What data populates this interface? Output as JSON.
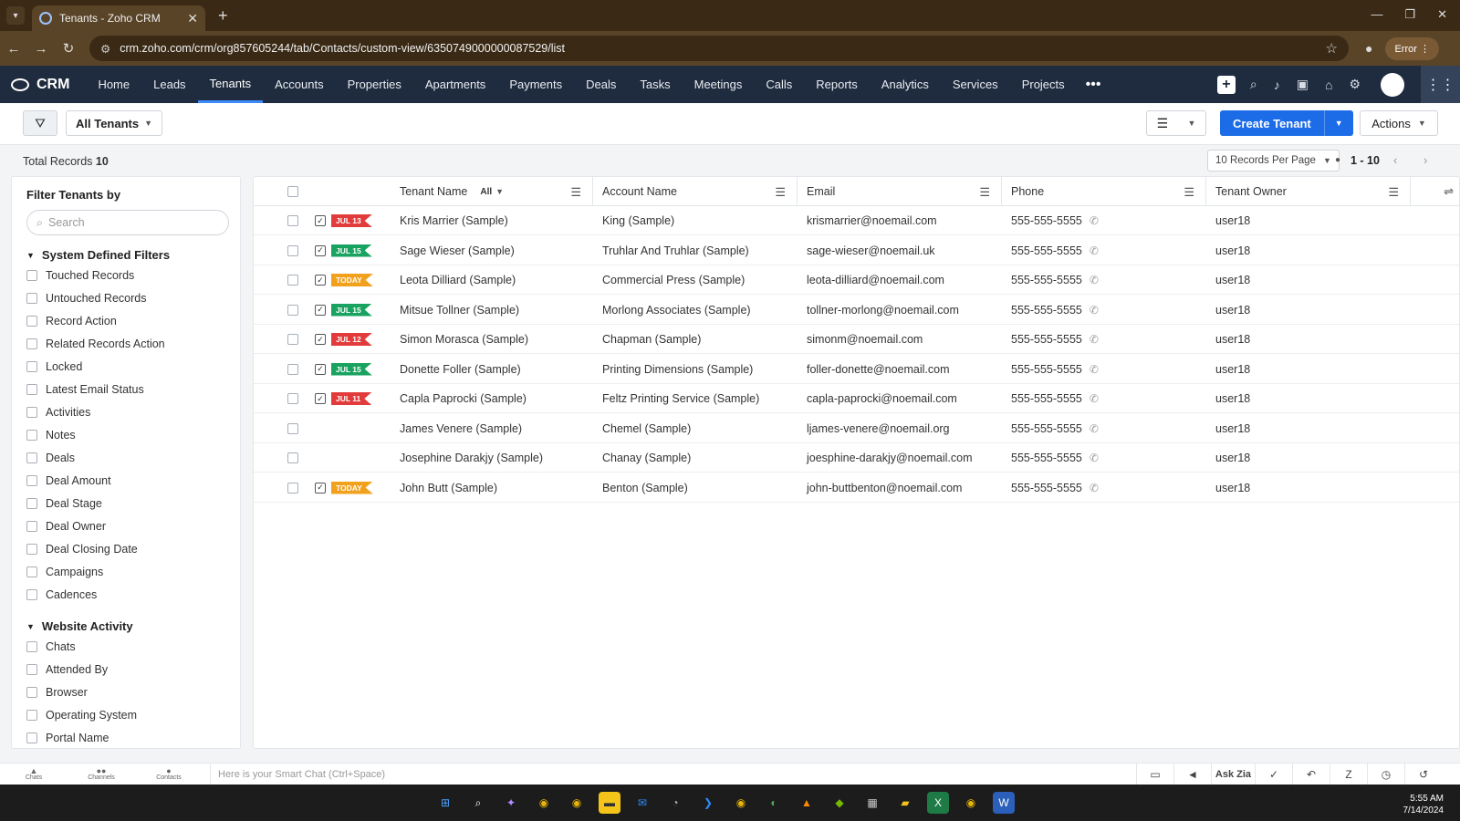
{
  "browser": {
    "tab_title": "Tenants - Zoho CRM",
    "url": "crm.zoho.com/crm/org857605244/tab/Contacts/custom-view/6350749000000087529/list",
    "error_label": "Error"
  },
  "nav": {
    "logo": "CRM",
    "items": [
      "Home",
      "Leads",
      "Tenants",
      "Accounts",
      "Properties",
      "Apartments",
      "Payments",
      "Deals",
      "Tasks",
      "Meetings",
      "Calls",
      "Reports",
      "Analytics",
      "Services",
      "Projects"
    ],
    "active": "Tenants",
    "more": "•••"
  },
  "toolbar": {
    "view": "All Tenants",
    "create": "Create Tenant",
    "actions": "Actions"
  },
  "records": {
    "total_label": "Total Records",
    "total": "10",
    "per_page": "10 Records Per Page",
    "range": "1 - 10"
  },
  "sidebar": {
    "title": "Filter Tenants by",
    "search_placeholder": "Search",
    "system_group": "System Defined Filters",
    "system_filters": [
      "Touched Records",
      "Untouched Records",
      "Record Action",
      "Related Records Action",
      "Locked",
      "Latest Email Status",
      "Activities",
      "Notes",
      "Deals",
      "Deal Amount",
      "Deal Stage",
      "Deal Owner",
      "Deal Closing Date",
      "Campaigns",
      "Cadences"
    ],
    "website_group": "Website Activity",
    "website_filters": [
      "Chats",
      "Attended By",
      "Browser",
      "Operating System",
      "Portal Name"
    ]
  },
  "table": {
    "columns": {
      "tenant_name": "Tenant Name",
      "tenant_filter": "All",
      "account_name": "Account Name",
      "email": "Email",
      "phone": "Phone",
      "owner": "Tenant Owner"
    },
    "rows": [
      {
        "task": true,
        "flag": "JUL 13",
        "flag_color": "#e23b3b",
        "name": "Kris Marrier (Sample)",
        "account": "King (Sample)",
        "email": "krismarrier@noemail.com",
        "phone": "555-555-5555",
        "owner": "user18"
      },
      {
        "task": true,
        "flag": "JUL 15",
        "flag_color": "#1aa360",
        "name": "Sage Wieser (Sample)",
        "account": "Truhlar And Truhlar (Sample)",
        "email": "sage-wieser@noemail.uk",
        "phone": "555-555-5555",
        "owner": "user18"
      },
      {
        "task": true,
        "flag": "TODAY",
        "flag_color": "#f2a11c",
        "name": "Leota Dilliard (Sample)",
        "account": "Commercial Press (Sample)",
        "email": "leota-dilliard@noemail.com",
        "phone": "555-555-5555",
        "owner": "user18"
      },
      {
        "task": true,
        "flag": "JUL 15",
        "flag_color": "#1aa360",
        "name": "Mitsue Tollner (Sample)",
        "account": "Morlong Associates (Sample)",
        "email": "tollner-morlong@noemail.com",
        "phone": "555-555-5555",
        "owner": "user18"
      },
      {
        "task": true,
        "flag": "JUL 12",
        "flag_color": "#e23b3b",
        "name": "Simon Morasca (Sample)",
        "account": "Chapman (Sample)",
        "email": "simonm@noemail.com",
        "phone": "555-555-5555",
        "owner": "user18"
      },
      {
        "task": true,
        "flag": "JUL 15",
        "flag_color": "#1aa360",
        "name": "Donette Foller (Sample)",
        "account": "Printing Dimensions (Sample)",
        "email": "foller-donette@noemail.com",
        "phone": "555-555-5555",
        "owner": "user18"
      },
      {
        "task": true,
        "flag": "JUL 11",
        "flag_color": "#e23b3b",
        "name": "Capla Paprocki (Sample)",
        "account": "Feltz Printing Service (Sample)",
        "email": "capla-paprocki@noemail.com",
        "phone": "555-555-5555",
        "owner": "user18"
      },
      {
        "task": false,
        "flag": "",
        "flag_color": "",
        "name": "James Venere (Sample)",
        "account": "Chemel (Sample)",
        "email": "ljames-venere@noemail.org",
        "phone": "555-555-5555",
        "owner": "user18"
      },
      {
        "task": false,
        "flag": "",
        "flag_color": "",
        "name": "Josephine Darakjy (Sample)",
        "account": "Chanay (Sample)",
        "email": "joesphine-darakjy@noemail.com",
        "phone": "555-555-5555",
        "owner": "user18"
      },
      {
        "task": true,
        "flag": "TODAY",
        "flag_color": "#f2a11c",
        "name": "John Butt (Sample)",
        "account": "Benton (Sample)",
        "email": "john-buttbenton@noemail.com",
        "phone": "555-555-5555",
        "owner": "user18"
      }
    ]
  },
  "chatbar": {
    "tabs": [
      "Chats",
      "Channels",
      "Contacts"
    ],
    "placeholder": "Here is your Smart Chat (Ctrl+Space)",
    "ask_zia": "Ask Zia"
  },
  "taskbar": {
    "time": "5:55 AM",
    "date": "7/14/2024"
  }
}
